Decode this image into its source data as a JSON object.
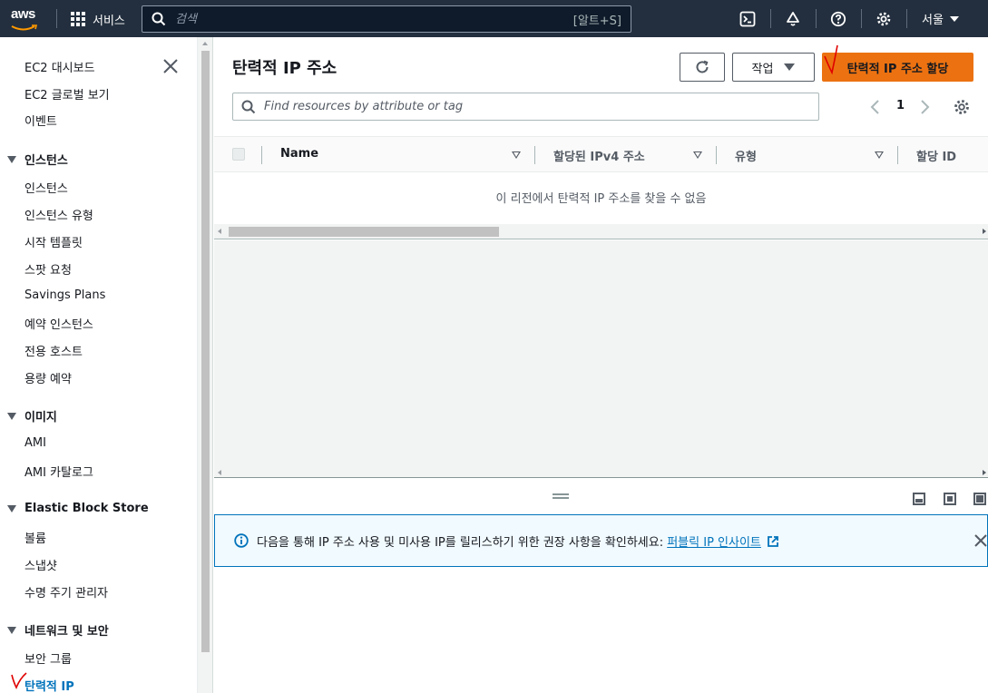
{
  "topnav": {
    "logo_text": "aws",
    "services_label": "서비스",
    "search_placeholder": "검색",
    "search_shortcut": "[알트+S]",
    "region_label": "서울",
    "icons": [
      "cloudshell-icon",
      "bell-icon",
      "help-icon",
      "settings-icon"
    ]
  },
  "sidebar": {
    "items_top": [
      "EC2 대시보드",
      "EC2 글로벌 보기",
      "이벤트"
    ],
    "sections": [
      {
        "title": "인스턴스",
        "items": [
          "인스턴스",
          "인스턴스 유형",
          "시작 템플릿",
          "스팟 요청",
          "Savings Plans",
          "예약 인스턴스",
          "전용 호스트",
          "용량 예약"
        ]
      },
      {
        "title": "이미지",
        "items": [
          "AMI",
          "AMI 카탈로그"
        ]
      },
      {
        "title": "Elastic Block Store",
        "items": [
          "볼륨",
          "스냅샷",
          "수명 주기 관리자"
        ]
      },
      {
        "title": "네트워크 및 보안",
        "items": [
          "보안 그룹",
          "탄력적 IP"
        ]
      }
    ],
    "active_item": "탄력적 IP"
  },
  "main": {
    "title": "탄력적 IP 주소",
    "actions_label": "작업",
    "allocate_label": "탄력적 IP 주소 할당",
    "filter_placeholder": "Find resources by attribute or tag",
    "page_number": "1",
    "columns": [
      "Name",
      "할당된 IPv4 주소",
      "유형",
      "할당 ID"
    ],
    "empty_message": "이 리전에서 탄력적 IP 주소를 찾을 수 없음"
  },
  "info_banner": {
    "message": "다음을 통해 IP 주소 사용 및 미사용 IP를 릴리스하기 위한 권장 사항을 확인하세요: ",
    "link_label": "퍼블릭 IP 인사이트"
  },
  "colors": {
    "nav_bg": "#232f3e",
    "primary": "#ec7211",
    "link": "#0073bb",
    "annotation": "#e00000"
  }
}
